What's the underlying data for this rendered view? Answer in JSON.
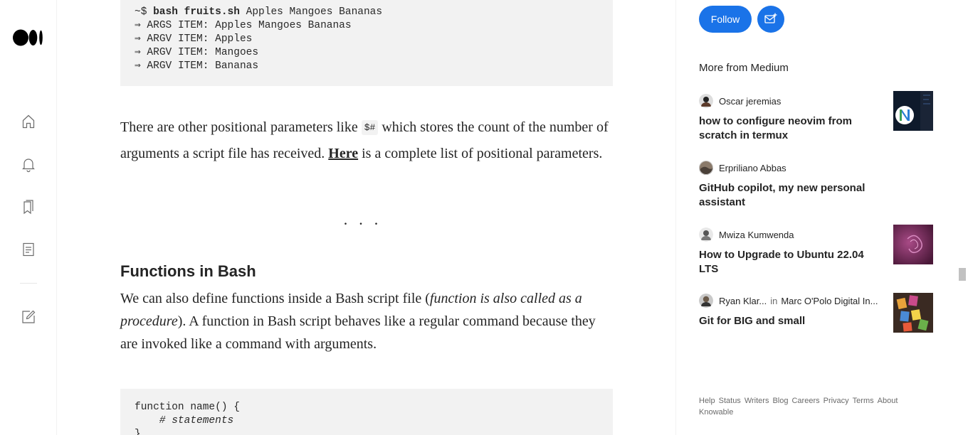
{
  "code_top": {
    "line1_prompt": "~$ ",
    "line1_cmd": "bash fruits.sh",
    "line1_args": " Apples Mangoes Bananas",
    "lines": [
      "⇒ ARGS ITEM: Apples Mangoes Bananas",
      "⇒ ARGV ITEM: Apples",
      "⇒ ARGV ITEM: Mangoes",
      "⇒ ARGV ITEM: Bananas"
    ]
  },
  "para1": {
    "before_code": "There are other positional parameters like ",
    "code": "$#",
    "after_code": " which stores the count of the number of arguments a script file has received. ",
    "link": "Here",
    "after_link": " is a complete list of positional parameters."
  },
  "separator": "...",
  "heading": "Functions in Bash",
  "para2": {
    "before_italic": "We can also define functions inside a Bash script file (",
    "italic": "function is also called as a procedure",
    "after_italic": "). A function in Bash script behaves like a regular command because they are invoked like a command with arguments."
  },
  "code_bottom": {
    "line1_kw": "function",
    "line1_rest": " name() {",
    "line2": "    # statements",
    "line3": "}"
  },
  "sidebar": {
    "follow_label": "Follow",
    "more_title": "More from Medium",
    "recommendations": [
      {
        "author": "Oscar jeremias",
        "publication": "",
        "title": "how to configure neovim from scratch in termux",
        "thumb_colors": [
          "#0e1a2b",
          "#1c6fd1"
        ]
      },
      {
        "author": "Erpriliano Abbas",
        "publication": "",
        "title": "GitHub copilot, my new personal assistant",
        "thumb_colors": []
      },
      {
        "author": "Mwiza Kumwenda",
        "publication": "",
        "title": "How to Upgrade to Ubuntu 22.04 LTS",
        "thumb_colors": [
          "#5a1f4a",
          "#8b3a6e"
        ]
      },
      {
        "author": "Ryan Klar...",
        "publication_prefix": "in",
        "publication": "Marc O'Polo Digital In...",
        "title": "Git for BIG and small",
        "thumb_colors": [
          "#3a2a22",
          "#e8a23a"
        ]
      }
    ],
    "footer_links": [
      "Help",
      "Status",
      "Writers",
      "Blog",
      "Careers",
      "Privacy",
      "Terms",
      "About",
      "Knowable"
    ]
  },
  "colors": {
    "accent": "#1a73e8",
    "text": "#242424",
    "muted": "#6b6b6b",
    "code_bg": "#f2f2f2"
  },
  "icons": [
    "medium-logo-icon",
    "home-icon",
    "bell-icon",
    "bookmarks-icon",
    "stories-icon",
    "write-icon",
    "subscribe-mail-icon"
  ]
}
